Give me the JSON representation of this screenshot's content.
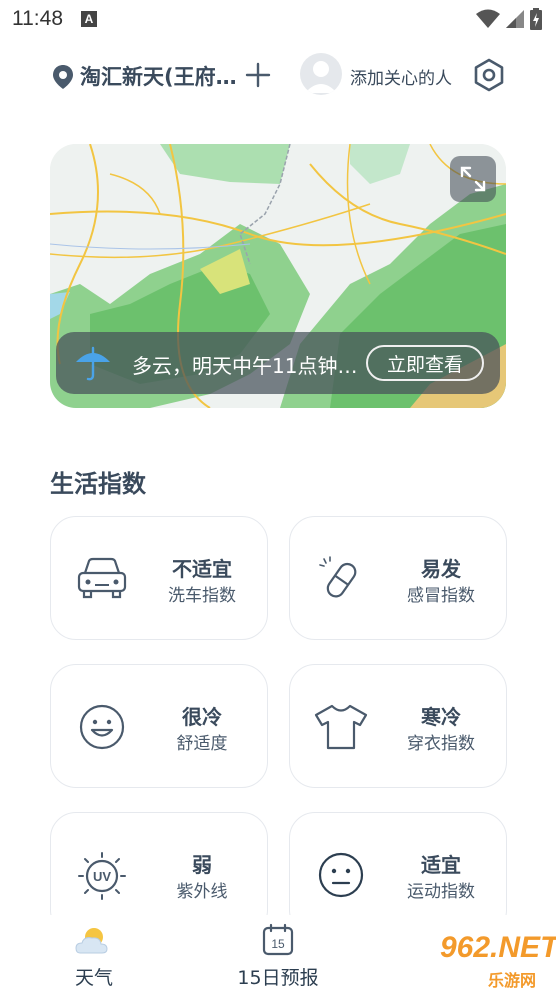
{
  "status_bar": {
    "time": "11:48",
    "notif_letter": "A"
  },
  "header": {
    "location": "淘汇新天(王府…",
    "care_label": "添加关心的人"
  },
  "map_card": {
    "alert_text": "多云，明天中午11点钟…",
    "view_button": "立即查看"
  },
  "life_index": {
    "title": "生活指数",
    "cards": [
      {
        "value": "不适宜",
        "label": "洗车指数",
        "icon": "car-icon"
      },
      {
        "value": "易发",
        "label": "感冒指数",
        "icon": "pill-icon"
      },
      {
        "value": "很冷",
        "label": "舒适度",
        "icon": "smile-face-icon"
      },
      {
        "value": "寒冷",
        "label": "穿衣指数",
        "icon": "tshirt-icon"
      },
      {
        "value": "弱",
        "label": "紫外线",
        "icon": "uv-sun-icon"
      },
      {
        "value": "适宜",
        "label": "运动指数",
        "icon": "neutral-face-icon"
      }
    ]
  },
  "bottom_nav": {
    "items": [
      {
        "label": "天气",
        "icon": "weather-cloud-sun-icon"
      },
      {
        "label": "15日预报",
        "icon": "calendar-icon",
        "icon_text": "15"
      }
    ]
  },
  "watermark": {
    "brand": "962.NET",
    "sub": "乐游网"
  },
  "colors": {
    "text": "#3a4a5c",
    "border": "#e6e9ee",
    "accent": "#f39a2b"
  }
}
